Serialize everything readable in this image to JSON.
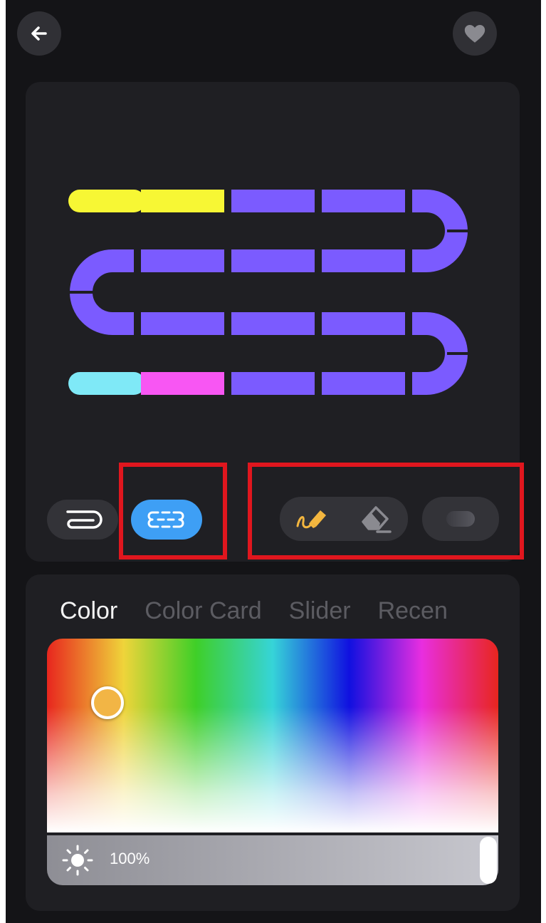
{
  "header": {
    "back_icon": "arrow-left-icon",
    "favorite_icon": "heart-icon"
  },
  "strip": {
    "colors": {
      "purple": "#7b5bff",
      "yellow": "#f7f734",
      "cyan": "#7fe9f7",
      "pink": "#f856f3"
    }
  },
  "toolbar": {
    "layout_modes": [
      "single-strip-icon",
      "multi-segment-icon"
    ],
    "selected_mode": "multi-segment",
    "tools": [
      "paint-brush-icon",
      "eraser-icon",
      "fill-toggle-icon"
    ],
    "highlight_color": "#e0161e"
  },
  "color_panel": {
    "tabs": [
      "Color",
      "Color Card",
      "Slider",
      "Recen"
    ],
    "active_tab": "Color",
    "selected_color": "#f2b545",
    "brightness": {
      "label": "100%",
      "value": 1.0
    }
  }
}
